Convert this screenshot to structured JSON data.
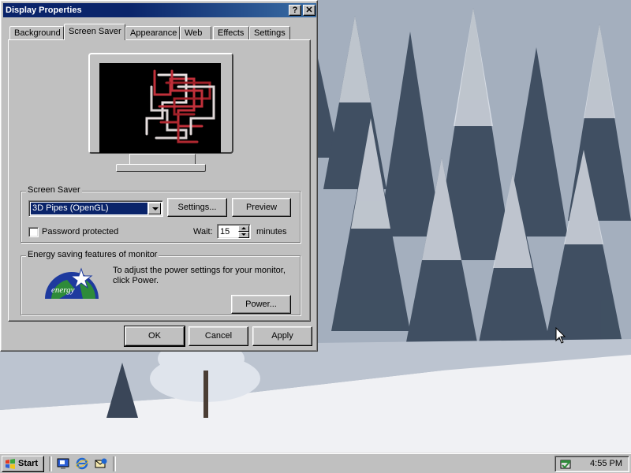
{
  "window": {
    "title": "Display Properties",
    "help_button": "?",
    "close_button": "✕"
  },
  "tabs": [
    {
      "label": "Background",
      "active": false
    },
    {
      "label": "Screen Saver",
      "active": true
    },
    {
      "label": "Appearance",
      "active": false
    },
    {
      "label": "Web",
      "active": false
    },
    {
      "label": "Effects",
      "active": false
    },
    {
      "label": "Settings",
      "active": false
    }
  ],
  "screen_saver": {
    "group_label": "Screen Saver",
    "selected": "3D Pipes (OpenGL)",
    "settings_button": "Settings...",
    "preview_button": "Preview",
    "password_label": "Password protected",
    "password_checked": false,
    "wait_label": "Wait:",
    "wait_value": "15",
    "wait_units": "minutes"
  },
  "energy": {
    "group_label": "Energy saving features of monitor",
    "description": "To adjust the power settings for your monitor, click Power.",
    "power_button": "Power...",
    "logo_text": "energy"
  },
  "buttons": {
    "ok": "OK",
    "cancel": "Cancel",
    "apply": "Apply"
  },
  "taskbar": {
    "start_label": "Start",
    "quick_launch": [
      "show-desktop-icon",
      "internet-explorer-icon",
      "outlook-express-icon"
    ],
    "tray_icon": "scheduler-icon",
    "clock": "4:55 PM"
  },
  "colors": {
    "titlebar": "#0a246a",
    "selection": "#0a246a",
    "face": "#c0c0c0"
  }
}
